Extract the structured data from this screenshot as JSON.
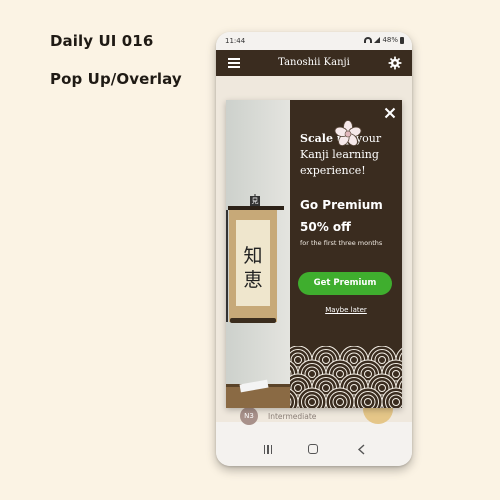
{
  "captions": {
    "title": "Daily UI 016",
    "subtitle": "Pop Up/Overlay"
  },
  "status_bar": {
    "time": "11:44",
    "battery": "48%"
  },
  "app_bar": {
    "title": "Tanoshii Kanji",
    "menu_icon": "hamburger-icon",
    "settings_icon": "gear-icon"
  },
  "popup": {
    "heading_bold": "Scale up",
    "heading_rest": " your Kanji learning experience!",
    "premium_title": "Go Premium",
    "discount": "50% off",
    "discount_detail": "for the first three months",
    "cta_label": "Get Premium",
    "dismiss_label": "Maybe later",
    "scroll_kanji": "知恵",
    "seal_kanji": "見"
  },
  "background_list": {
    "badge": "N3",
    "label": "Intermediate"
  },
  "colors": {
    "page_bg": "#fbf3e4",
    "brand_dark": "#3a2c1f",
    "cta_green": "#3fae2e",
    "accent_gold": "#e3c27e"
  }
}
